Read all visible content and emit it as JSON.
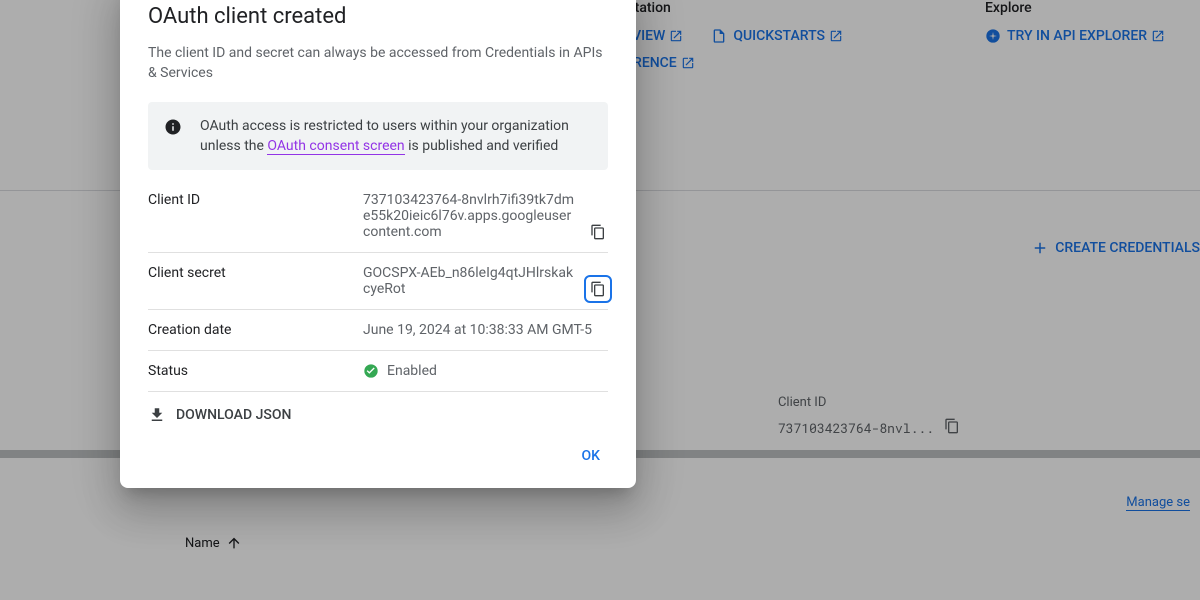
{
  "modal": {
    "title": "OAuth client created",
    "subtitle": "The client ID and secret can always be accessed from Credentials in APIs & Services",
    "info_text_before": "OAuth access is restricted to users within your organization unless the ",
    "info_link": "OAuth consent screen",
    "info_text_after": " is published and verified",
    "client_id_label": "Client ID",
    "client_id_value": "737103423764-8nvlrh7ifi39tk7dme55k20ieic6l76v.apps.googleusercontent.com",
    "client_secret_label": "Client secret",
    "client_secret_value": "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",
    "creation_date_label": "Creation date",
    "creation_date_value": "June 19, 2024 at 10:38:33 AM GMT-5",
    "status_label": "Status",
    "status_value": "Enabled",
    "download_label": "DOWNLOAD JSON",
    "ok_label": "OK"
  },
  "bg": {
    "doc_header": "Documentation",
    "explore_header": "Explore",
    "overview": "OVERVIEW",
    "quickstarts": "QUICKSTARTS",
    "api_ref": "API REFERENCE",
    "try_explorer": "TRY IN API EXPLORER",
    "create_cred": "CREATE CREDENTIALS",
    "client_id_label": "Client ID",
    "client_id_short": "737103423764-8nvl...",
    "manage": "Manage se",
    "name_col": "Name"
  }
}
